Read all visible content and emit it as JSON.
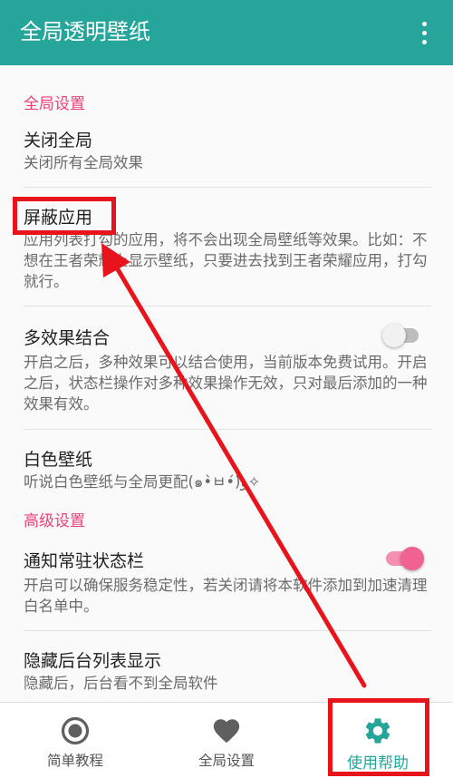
{
  "app_title": "全局透明壁纸",
  "sections": {
    "global_header": "全局设置",
    "advanced_header": "高级设置"
  },
  "prefs": {
    "close_global": {
      "title": "关闭全局",
      "summary": "关闭所有全局效果"
    },
    "block_apps": {
      "title": "屏蔽应用",
      "summary": "应用列表打勾的应用，将不会出现全局壁纸等效果。比如：不想在王者荣耀上显示壁纸，只要进去找到王者荣耀应用，打勾就行。"
    },
    "multi_effect": {
      "title": "多效果结合",
      "summary": "开启之后，多种效果可以结合使用，当前版本免费试用。开启之后，状态栏操作对多种效果操作无效，只对最后添加的一种效果有效。",
      "enabled": false
    },
    "white_wallpaper": {
      "title": "白色壁纸",
      "summary": "听说白色壁纸与全局更配(๑•̀ㅂ•́)و✧"
    },
    "notify_bar": {
      "title": "通知常驻状态栏",
      "summary": "开启可以确保服务稳定性，若关闭请将本软件添加到加速清理白名单中。",
      "enabled": true
    },
    "hide_recents": {
      "title": "隐藏后台列表显示",
      "summary": "隐藏后，后台看不到全局软件"
    }
  },
  "bottom_nav": {
    "items": [
      {
        "label": "简单教程",
        "icon": "radio-button-icon"
      },
      {
        "label": "全局设置",
        "icon": "heart-icon"
      },
      {
        "label": "使用帮助",
        "icon": "gear-icon"
      }
    ],
    "active_index": 2
  },
  "colors": {
    "primary": "#26a69a",
    "accent": "#ec407a",
    "annotation": "#e8141b"
  }
}
